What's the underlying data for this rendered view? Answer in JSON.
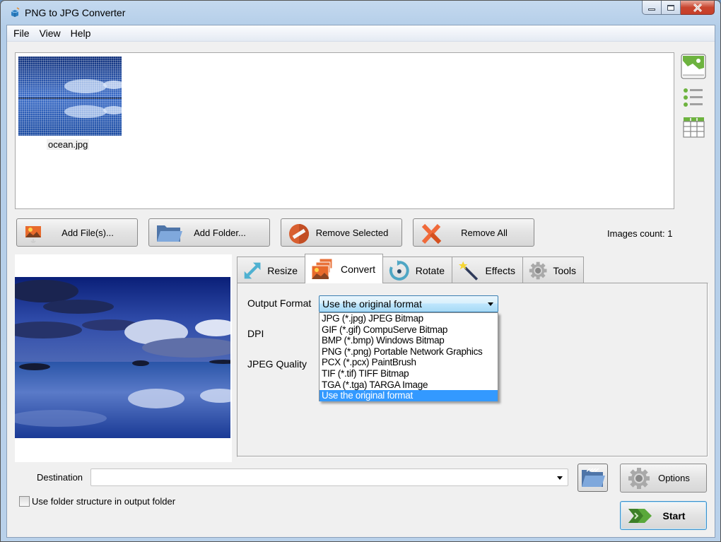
{
  "window": {
    "title": "PNG to JPG Converter",
    "controls": {
      "minimize": "minimize-icon",
      "maximize": "maximize-icon",
      "close": "close-icon"
    }
  },
  "menu": [
    "File",
    "View",
    "Help"
  ],
  "file_list": {
    "items": [
      {
        "name": "ocean.jpg",
        "icon": "image-thumbnail"
      }
    ]
  },
  "view_modes": [
    {
      "name": "thumbnails-view",
      "icon": "image-icon",
      "active": true
    },
    {
      "name": "list-view",
      "icon": "list-icon",
      "active": false
    },
    {
      "name": "table-view",
      "icon": "table-icon",
      "active": false
    }
  ],
  "toolbar": {
    "add_files": "Add File(s)...",
    "add_folder": "Add Folder...",
    "remove_selected": "Remove Selected",
    "remove_all": "Remove All",
    "images_count": "Images count: 1"
  },
  "tabs": [
    {
      "label": "Resize",
      "icon": "resize-icon",
      "active": false
    },
    {
      "label": "Convert",
      "icon": "convert-icon",
      "active": true
    },
    {
      "label": "Rotate",
      "icon": "rotate-icon",
      "active": false
    },
    {
      "label": "Effects",
      "icon": "magic-wand-icon",
      "active": false
    },
    {
      "label": "Tools",
      "icon": "gear-icon",
      "active": false
    }
  ],
  "convert": {
    "output_format_label": "Output Format",
    "output_format_value": "Use the original format",
    "dpi_label": "DPI",
    "jpeg_quality_label": "JPEG Quality",
    "format_options": [
      "JPG (*.jpg) JPEG Bitmap",
      "GIF (*.gif) CompuServe Bitmap",
      "BMP (*.bmp) Windows Bitmap",
      "PNG (*.png) Portable Network Graphics",
      "PCX (*.pcx) PaintBrush",
      "TIF (*.tif) TIFF Bitmap",
      "TGA (*.tga) TARGA Image",
      "Use the original format"
    ],
    "selected_index": 7
  },
  "destination": {
    "label": "Destination",
    "value": "",
    "use_folder_structure_label": "Use folder structure in output folder",
    "use_folder_structure_checked": false
  },
  "actions": {
    "options": "Options",
    "start": "Start"
  },
  "colors": {
    "selection": "#3399ff",
    "close_button": "#c7402a",
    "start_accent": "#5aa83a"
  }
}
